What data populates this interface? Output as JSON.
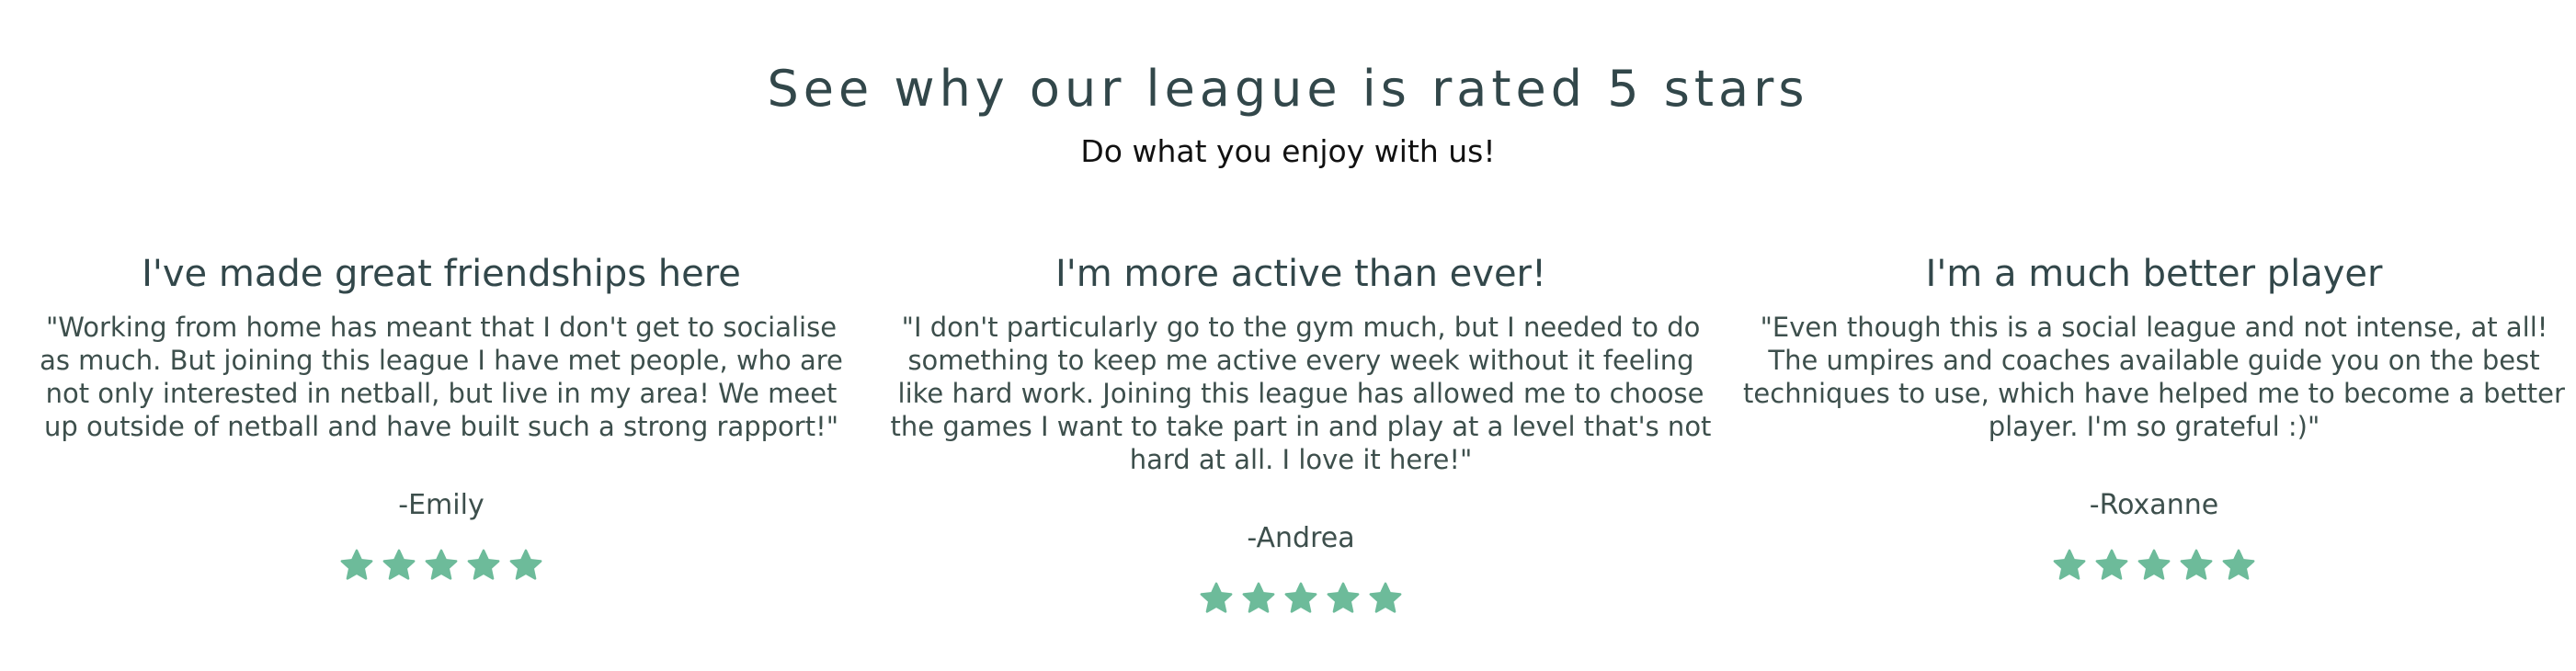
{
  "section": {
    "heading": "See why our league is rated 5 stars",
    "subheading": "Do what you enjoy with us!"
  },
  "reviews": [
    {
      "title": "I've made great friendships here",
      "text": "\"Working from home has meant that I don't get to socialise as much. But joining this league I have met people, who are not only interested in netball, but live in my area! We meet up outside of netball and have built such a strong rapport!\"",
      "author": "-Emily",
      "rating": 5
    },
    {
      "title": "I'm more active than ever!",
      "text": "\"I don't particularly go to the gym much, but I needed to do something to keep me active every week without it feeling like hard work. Joining this league has allowed me to choose the games I want to take part in and play at a level that's not hard at all. I love it here!\"",
      "author": "-Andrea",
      "rating": 5
    },
    {
      "title": "I'm a much better player",
      "text": "\"Even though this is a social league and not intense, at all! The umpires and coaches available guide you on the best techniques to use, which have helped me to become a better player. I'm so grateful :)\"",
      "author": "-Roxanne",
      "rating": 5
    }
  ],
  "colors": {
    "star": "#6dbb9a",
    "heading": "#32474a",
    "text": "#3d4f4c"
  },
  "icons": {
    "rating": "star-icon"
  }
}
